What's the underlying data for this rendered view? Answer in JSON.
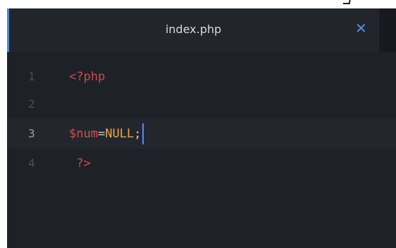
{
  "tab": {
    "title": "index.php",
    "close_symbol": "✕"
  },
  "lines": [
    {
      "number": "1",
      "tokens": {
        "open_tag": "<?php"
      }
    },
    {
      "number": "2",
      "tokens": {}
    },
    {
      "number": "3",
      "tokens": {
        "var": "$num",
        "op": "=",
        "const": "NULL",
        "punc": ";"
      }
    },
    {
      "number": "4",
      "tokens": {
        "close_tag": "?>"
      }
    }
  ],
  "colors": {
    "accent": "#4f86d6",
    "background": "#1e2127",
    "php_tag": "#c94c4c",
    "variable": "#d05050",
    "constant": "#e5a94d"
  },
  "active_line": "3"
}
